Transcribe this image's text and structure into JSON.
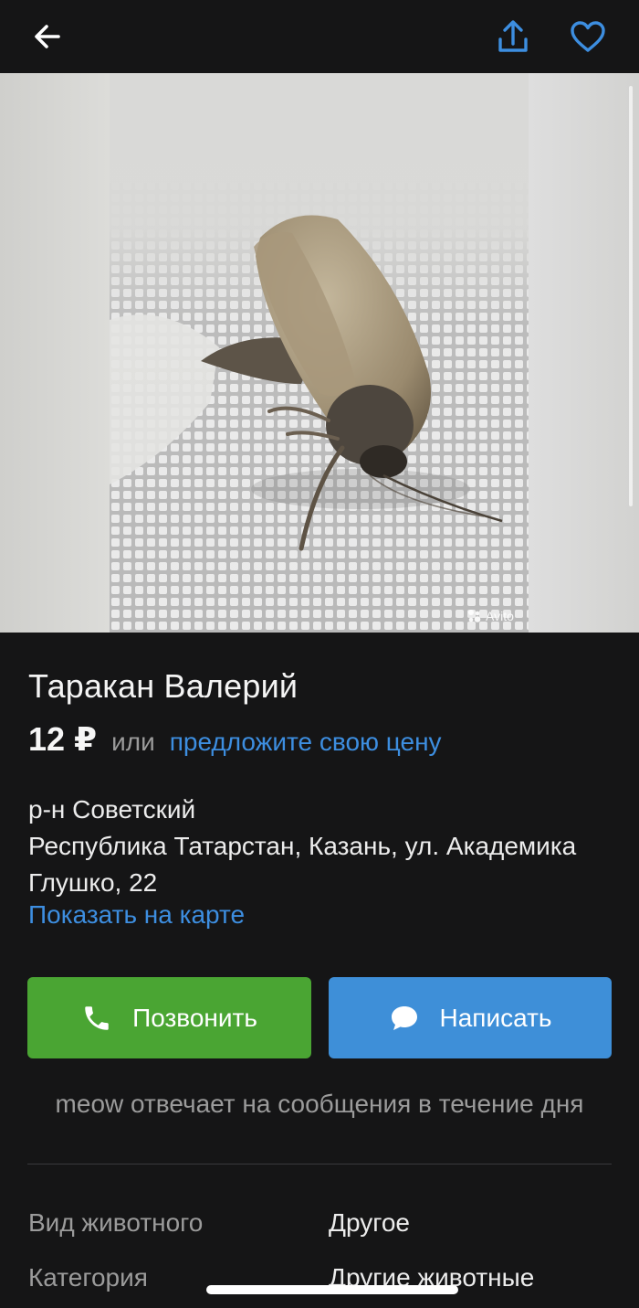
{
  "header": {
    "back_icon": "arrow-left-icon",
    "share_icon": "share-icon",
    "favorite_icon": "heart-outline-icon",
    "accent": "#3d8ee0"
  },
  "photo": {
    "watermark": "Avito"
  },
  "listing": {
    "title": "Таракан Валерий",
    "price": "12 ₽",
    "price_or": "или",
    "price_offer": "предложите свою цену",
    "district": "р-н Советский",
    "address_line1": "Республика Татарстан, Казань, ул. Академика",
    "address_line2": "Глушко, 22",
    "map_link": "Показать на карте"
  },
  "actions": {
    "call_label": "Позвонить",
    "call_color": "#4aa533",
    "write_label": "Написать",
    "write_color": "#3e8fd8"
  },
  "seller": {
    "reply_note": "meow отвечает на сообщения в течение дня"
  },
  "params": [
    {
      "key": "Вид животного",
      "value": "Другое"
    },
    {
      "key": "Категория",
      "value": "Другие животные"
    }
  ]
}
